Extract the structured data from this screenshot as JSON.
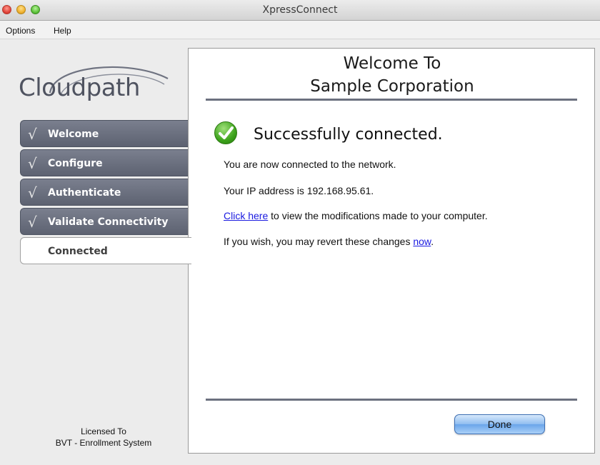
{
  "window": {
    "title": "XpressConnect"
  },
  "menu": {
    "items": [
      "Options",
      "Help"
    ]
  },
  "sidebar": {
    "logo_text": "Cloudpath",
    "steps": [
      {
        "label": "Welcome",
        "done": true
      },
      {
        "label": "Configure",
        "done": true
      },
      {
        "label": "Authenticate",
        "done": true
      },
      {
        "label": "Validate Connectivity",
        "done": true
      },
      {
        "label": "Connected",
        "done": false,
        "active": true
      }
    ],
    "check_glyph": "√",
    "license_line1": "Licensed To",
    "license_line2": "BVT - Enrollment System"
  },
  "main": {
    "title_line1": "Welcome To",
    "title_line2": "Sample Corporation",
    "status_icon": "success-check-icon",
    "status_text": "Successfully connected.",
    "line1": "You are now connected to the network.",
    "line2": "Your IP address is 192.168.95.61.",
    "line3_link": "Click here",
    "line3_rest": " to view the modifications made to your computer.",
    "line4_prefix": "If you wish, you may revert these changes ",
    "line4_link": "now",
    "line4_suffix": ".",
    "done_label": "Done"
  },
  "colors": {
    "step_bg": "#6a6f7d",
    "rule": "#6c717f",
    "link": "#1a1ae0",
    "success": "#3da31c"
  }
}
